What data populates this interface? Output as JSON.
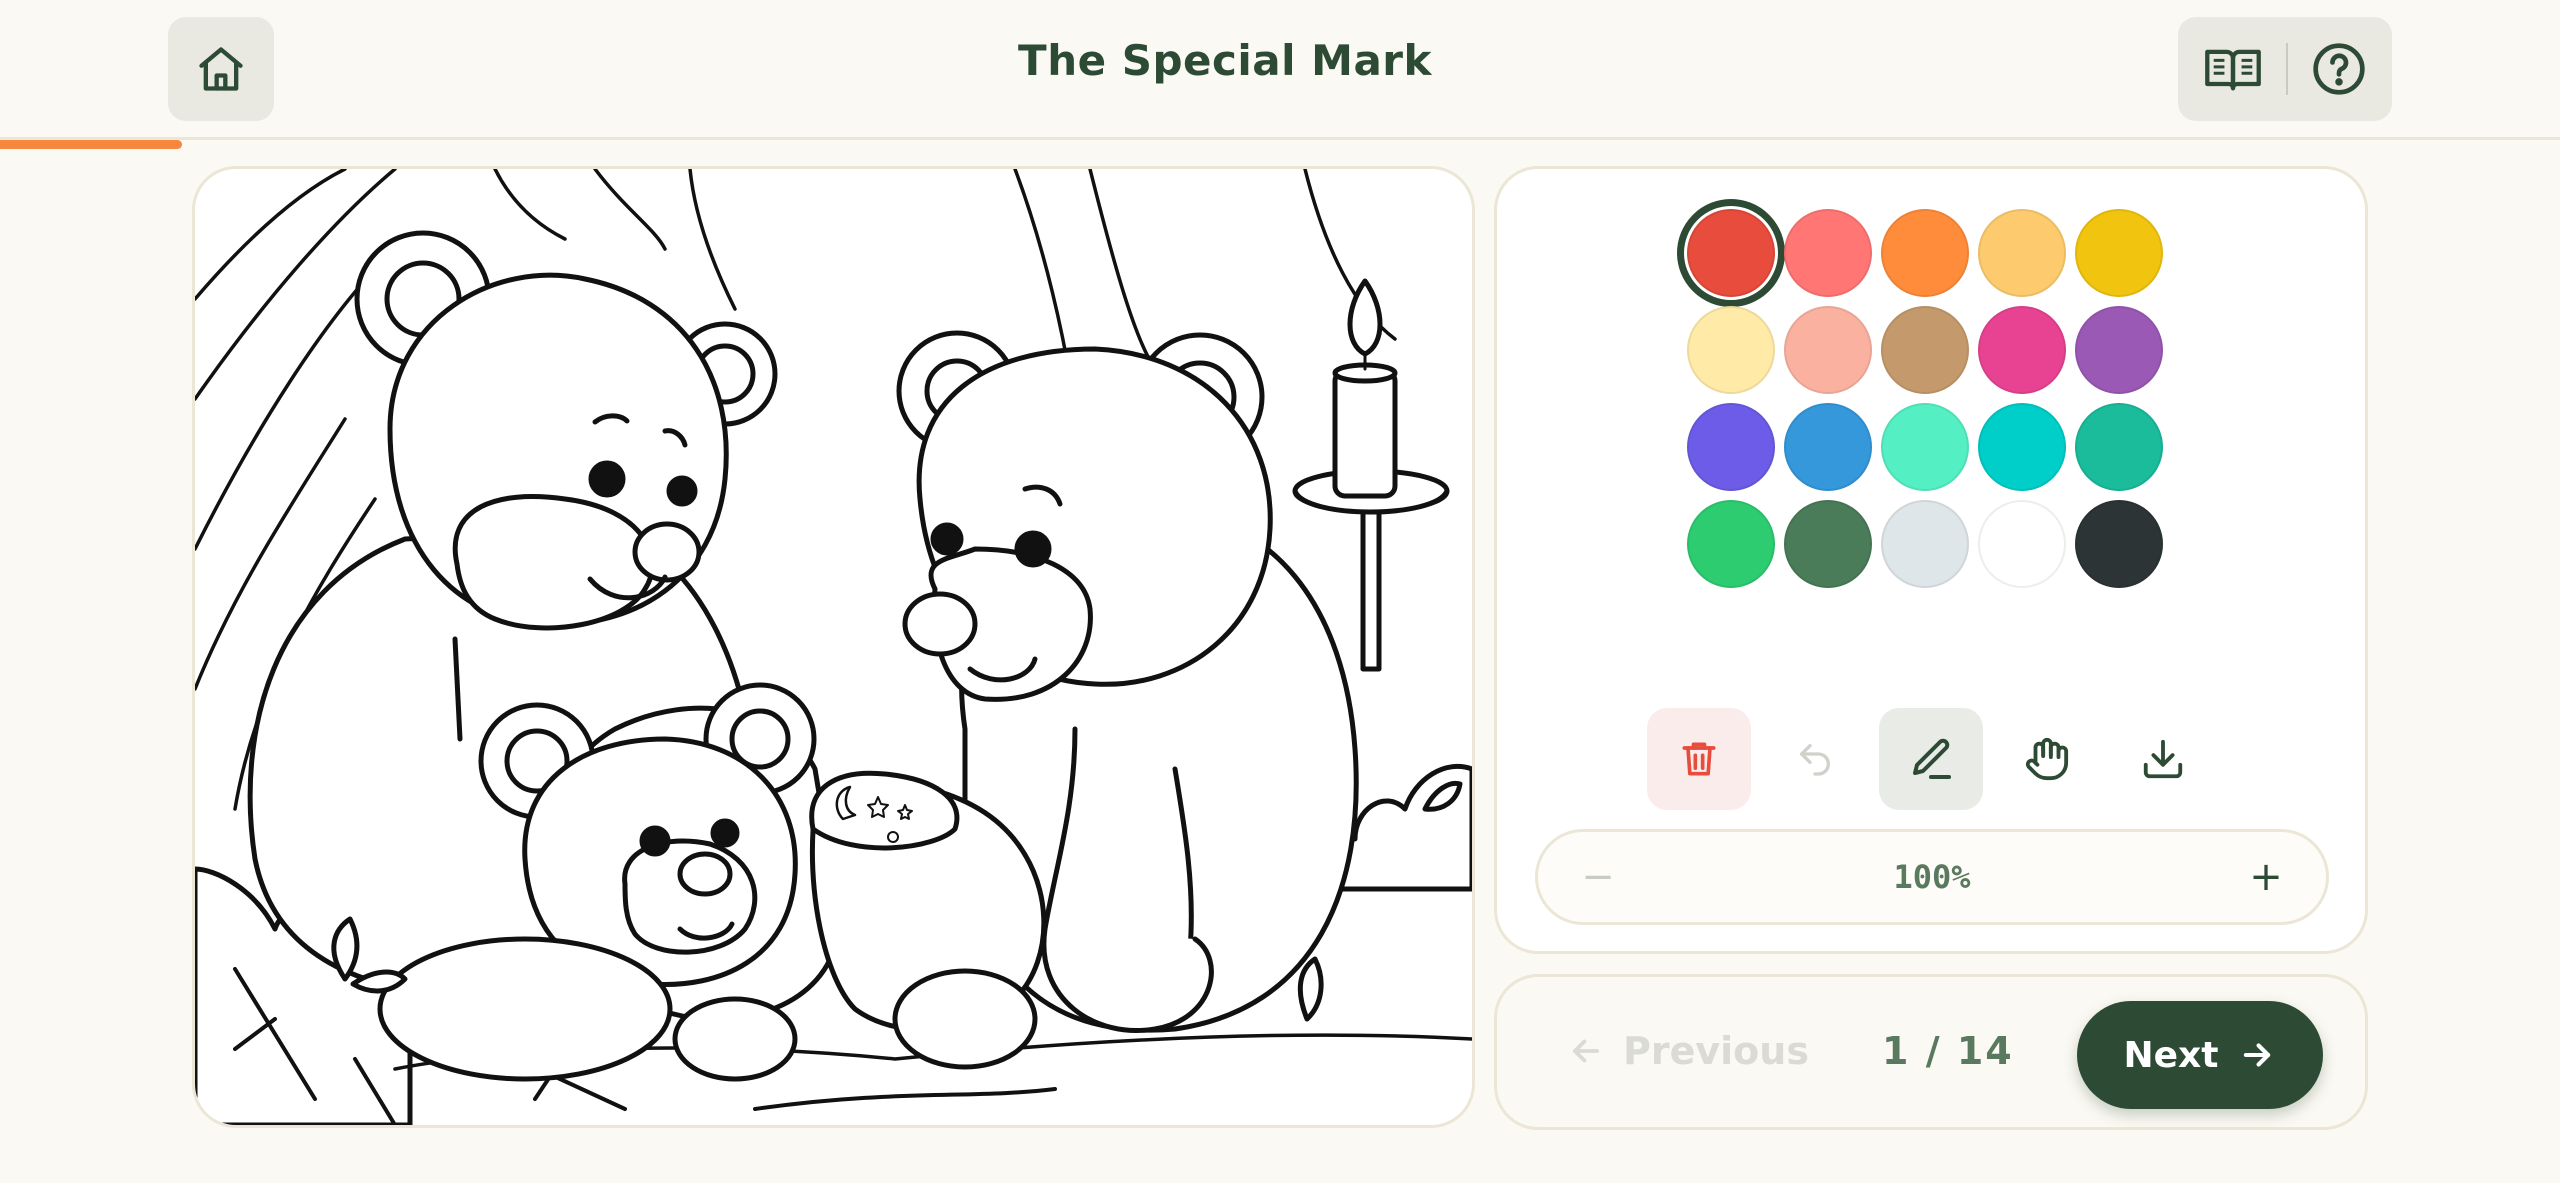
{
  "header": {
    "title": "The Special Mark",
    "home_icon": "home-icon",
    "book_icon": "book-icon",
    "help_icon": "help-icon",
    "progress_fraction": 0.071
  },
  "palette": {
    "selected_index": 0,
    "colors": [
      "#e74c3c",
      "#ff7675",
      "#ff8c3a",
      "#fdcb6e",
      "#f1c40f",
      "#ffeaa7",
      "#fab1a0",
      "#c49a6c",
      "#e84393",
      "#9b59b6",
      "#6c5ce7",
      "#3498db",
      "#55efc4",
      "#00cec9",
      "#1abc9c",
      "#2ecc71",
      "#4a7c59",
      "#dfe6e9",
      "#ffffff",
      "#2d3436"
    ]
  },
  "tools": {
    "items": [
      "trash-icon",
      "undo-icon",
      "pencil-icon",
      "hand-icon",
      "download-icon"
    ],
    "active": "pencil-icon"
  },
  "zoom": {
    "minus": "−",
    "value": "100%",
    "plus": "+"
  },
  "nav": {
    "previous_label": "Previous",
    "page_current": "1",
    "page_sep": "/",
    "page_total": "14",
    "next_label": "Next"
  }
}
